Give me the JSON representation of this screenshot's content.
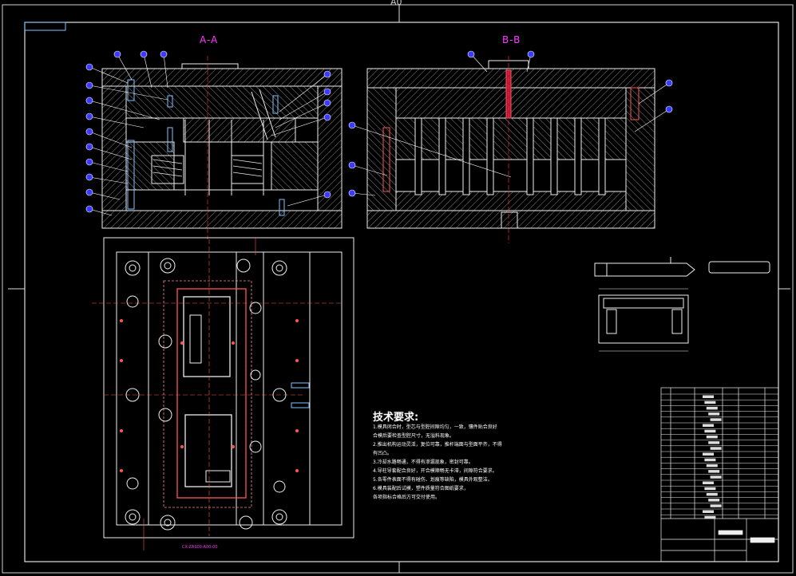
{
  "views": {
    "section_aa_label": "A-A",
    "section_bb_label": "B-B",
    "top_mark": "A0"
  },
  "technical_requirements": {
    "title": "技术要求:",
    "notes": [
      "1.模具闭合时，型芯与型腔间隙均匀，一致，镶件贴合良好",
      "  合模后要检查型腔尺寸，无溢料现象。",
      "2.推出机构运动灵活，复位可靠，推杆端面与型面平齐，不得",
      "  有凹凸。",
      "3.冷却水路畅通，不得有渗漏现象，密封可靠。",
      "4.导柱导套配合良好，开合模顺畅无卡滞，间隙符合要求。",
      "5.各零件表面不得有碰伤、划痕等缺陷，模具外观整洁。",
      "6.模具装配后试模，塑件质量符合图纸要求，",
      "  各项指标合格后方可交付使用。"
    ]
  },
  "drawing_number": "CX-ZAS00-A00-00"
}
